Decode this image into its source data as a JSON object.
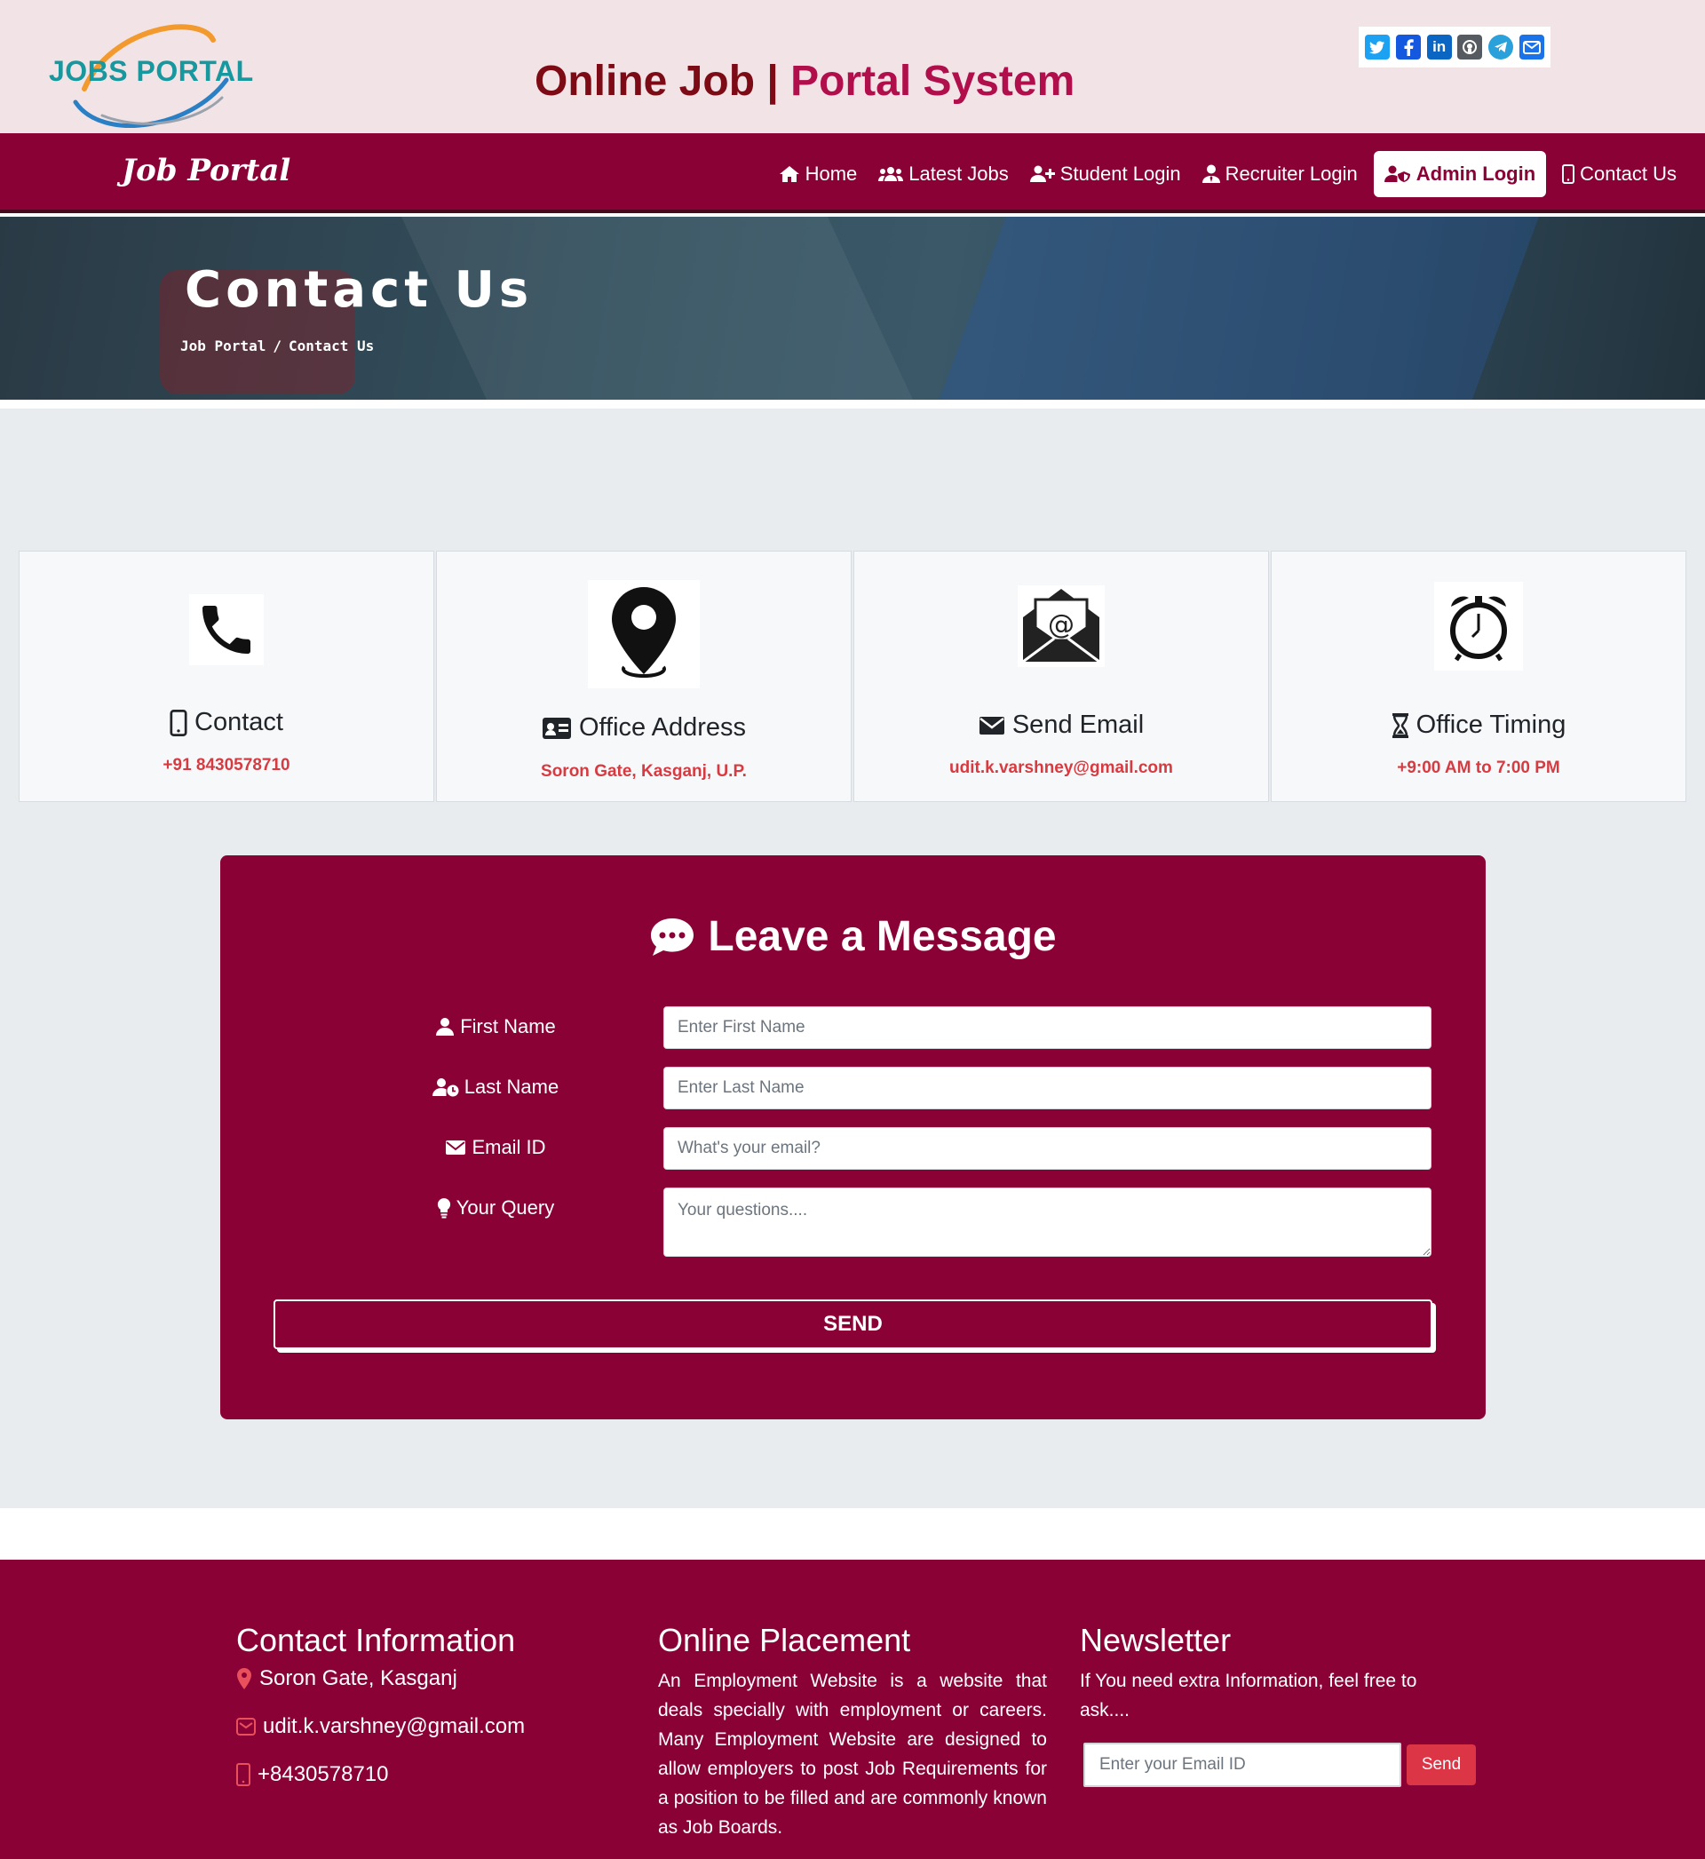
{
  "header": {
    "logo_text": "JOBS PORTAL",
    "title_part1": "Online Job |",
    "title_part2": "Portal System",
    "social_icons": [
      "twitter-icon",
      "facebook-icon",
      "linkedin-icon",
      "github-icon",
      "telegram-icon",
      "email-icon"
    ]
  },
  "navbar": {
    "brand": "Job Portal",
    "items": [
      {
        "label": "Home",
        "icon": "home-icon"
      },
      {
        "label": "Latest Jobs",
        "icon": "users-icon"
      },
      {
        "label": "Student Login",
        "icon": "user-plus-icon"
      },
      {
        "label": "Recruiter Login",
        "icon": "user-tie-icon"
      },
      {
        "label": "Admin Login",
        "icon": "user-shield-icon",
        "active": true
      },
      {
        "label": "Contact Us",
        "icon": "mobile-icon"
      }
    ]
  },
  "hero": {
    "title": "Contact Us",
    "breadcrumb_root": "Job Portal",
    "breadcrumb_sep": "/",
    "breadcrumb_current": "Contact Us"
  },
  "cards": [
    {
      "heading": "Contact",
      "value": "+91 8430578710",
      "icon": "phone-icon"
    },
    {
      "heading": "Office Address",
      "value": "Soron Gate, Kasganj, U.P.",
      "icon": "location-pin-icon"
    },
    {
      "heading": "Send Email",
      "value": "udit.k.varshney@gmail.com",
      "icon": "envelope-at-icon"
    },
    {
      "heading": "Office Timing",
      "value": "+9:00 AM to 7:00 PM",
      "icon": "alarm-clock-icon"
    }
  ],
  "form": {
    "title": "Leave a Message",
    "first_name_label": "First Name",
    "first_name_placeholder": "Enter First Name",
    "last_name_label": "Last Name",
    "last_name_placeholder": "Enter Last Name",
    "email_label": "Email ID",
    "email_placeholder": "What's your email?",
    "query_label": "Your Query",
    "query_placeholder": "Your questions....",
    "send_label": "SEND"
  },
  "footer": {
    "contact_heading": "Contact Information",
    "address": "Soron Gate, Kasganj",
    "email": "udit.k.varshney@gmail.com",
    "phone": "+8430578710",
    "placement_heading": "Online Placement",
    "placement_text": "An Employment Website is a website that deals specially with employment or careers. Many Employment Website are designed to allow employers to post Job Requirements for a position to be filled and are commonly known as Job Boards.",
    "newsletter_heading": "Newsletter",
    "newsletter_text": "If You need extra Information, feel free to ask....",
    "newsletter_placeholder": "Enter your Email ID",
    "newsletter_button": "Send"
  },
  "colors": {
    "primary": "#8a0136",
    "header_bg": "#f2e4e6",
    "accent_red": "#d73b42",
    "title_dark": "#7d0b16",
    "title_pink": "#b10e4c",
    "section_bg": "#e9ecef"
  }
}
